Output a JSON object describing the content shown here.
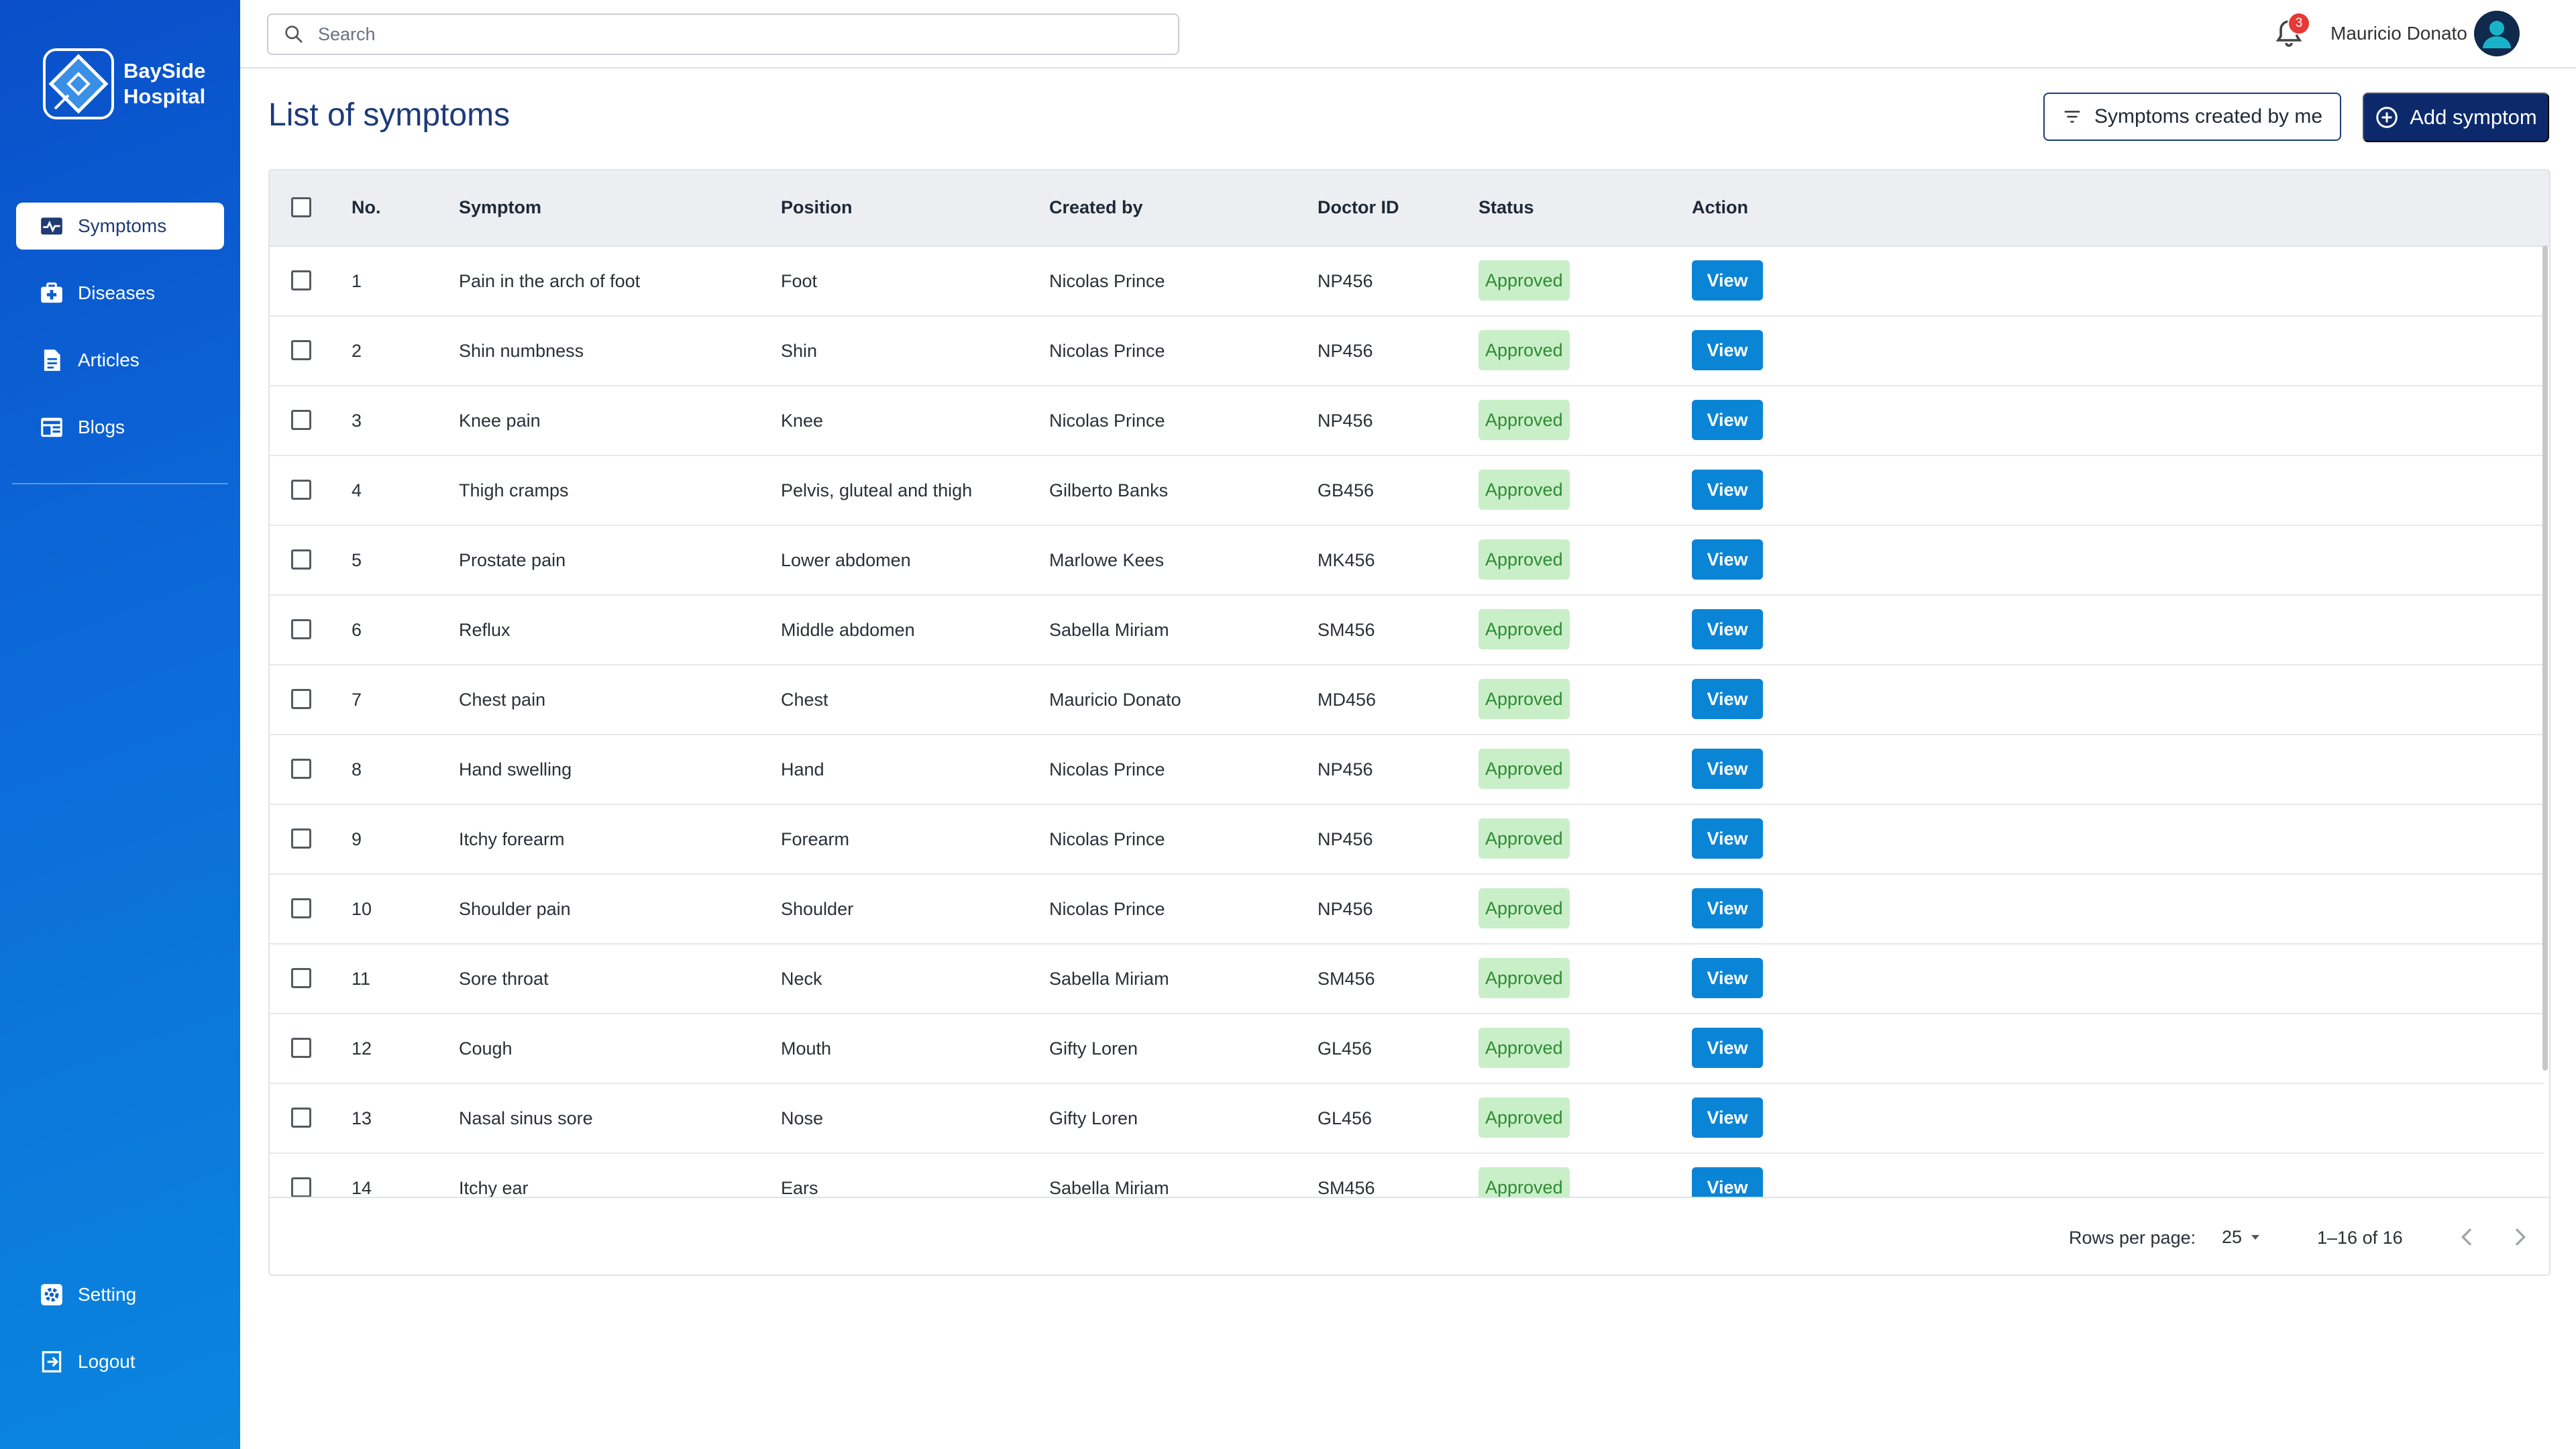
{
  "brand": {
    "line1": "BaySide",
    "line2": "Hospital"
  },
  "sidebar": {
    "items": [
      {
        "label": "Symptoms",
        "icon": "pulse-icon",
        "active": true
      },
      {
        "label": "Diseases",
        "icon": "medkit-icon"
      },
      {
        "label": "Articles",
        "icon": "article-icon"
      },
      {
        "label": "Blogs",
        "icon": "blog-icon"
      }
    ],
    "bottom": [
      {
        "label": "Setting",
        "icon": "settings-icon"
      },
      {
        "label": "Logout",
        "icon": "logout-icon"
      }
    ]
  },
  "topbar": {
    "search_placeholder": "Search",
    "notifications": "3",
    "user_name": "Mauricio Donato"
  },
  "page": {
    "title": "List of symptoms",
    "filter_label": "Symptoms created by me",
    "add_label": "Add symptom"
  },
  "table": {
    "columns": [
      "No.",
      "Symptom",
      "Position",
      "Created by",
      "Doctor ID",
      "Status",
      "Action"
    ],
    "rows": [
      [
        "1",
        "Pain in the arch of foot",
        "Foot",
        "Nicolas Prince",
        "NP456",
        "Approved",
        "View"
      ],
      [
        "2",
        "Shin numbness",
        "Shin",
        "Nicolas Prince",
        "NP456",
        "Approved",
        "View"
      ],
      [
        "3",
        "Knee pain",
        "Knee",
        "Nicolas Prince",
        "NP456",
        "Approved",
        "View"
      ],
      [
        "4",
        "Thigh cramps",
        "Pelvis, gluteal and thigh",
        "Gilberto Banks",
        "GB456",
        "Approved",
        "View"
      ],
      [
        "5",
        "Prostate pain",
        "Lower abdomen",
        "Marlowe Kees",
        "MK456",
        "Approved",
        "View"
      ],
      [
        "6",
        "Reflux",
        "Middle abdomen",
        "Sabella Miriam",
        "SM456",
        "Approved",
        "View"
      ],
      [
        "7",
        "Chest pain",
        "Chest",
        "Mauricio Donato",
        "MD456",
        "Approved",
        "View"
      ],
      [
        "8",
        "Hand swelling",
        "Hand",
        "Nicolas Prince",
        "NP456",
        "Approved",
        "View"
      ],
      [
        "9",
        "Itchy forearm",
        "Forearm",
        "Nicolas Prince",
        "NP456",
        "Approved",
        "View"
      ],
      [
        "10",
        "Shoulder pain",
        "Shoulder",
        "Nicolas Prince",
        "NP456",
        "Approved",
        "View"
      ],
      [
        "11",
        "Sore throat",
        "Neck",
        "Sabella Miriam",
        "SM456",
        "Approved",
        "View"
      ],
      [
        "12",
        "Cough",
        "Mouth",
        "Gifty Loren",
        "GL456",
        "Approved",
        "View"
      ],
      [
        "13",
        "Nasal sinus sore",
        "Nose",
        "Gifty Loren",
        "GL456",
        "Approved",
        "View"
      ],
      [
        "14",
        "Itchy ear",
        "Ears",
        "Sabella Miriam",
        "SM456",
        "Approved",
        "View"
      ]
    ]
  },
  "pagination": {
    "rows_per_page_label": "Rows per page:",
    "rows_per_page": "25",
    "range": "1–16 of 16"
  },
  "colors": {
    "accent": "#0c2a6b",
    "view_button": "#0a85d6",
    "status_bg": "#c9efc8",
    "status_text": "#2e8b34"
  }
}
